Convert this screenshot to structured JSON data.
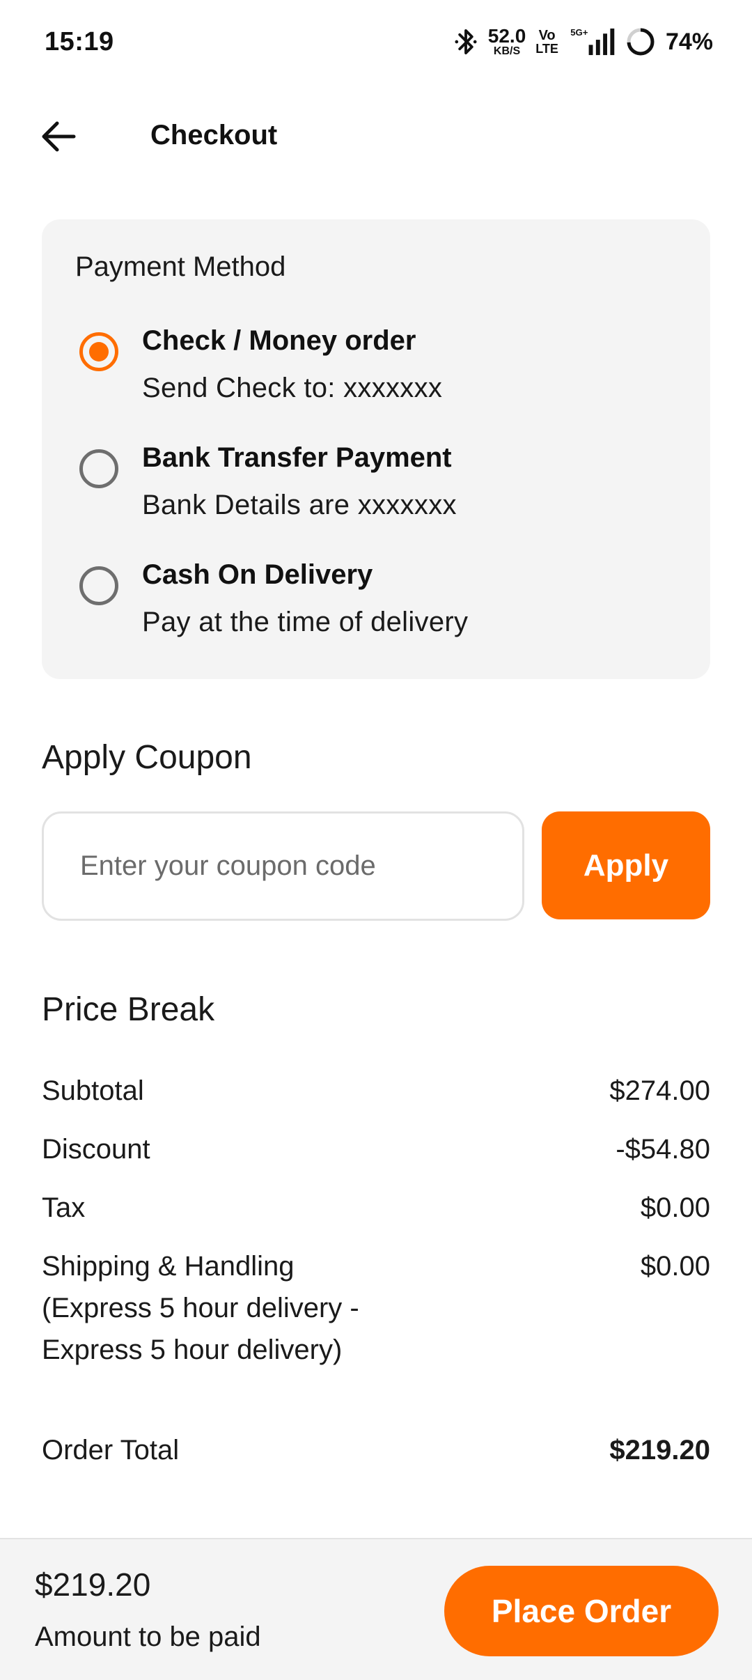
{
  "status_bar": {
    "time": "15:19",
    "net_speed_value": "52.0",
    "net_speed_unit": "KB/S",
    "volte_top": "Vo",
    "volte_bottom": "LTE",
    "network_label": "5G+",
    "battery_percent": "74%",
    "battery_level": 0.74,
    "icons": [
      "bluetooth-icon",
      "signal-icon",
      "battery-icon"
    ]
  },
  "header": {
    "title": "Checkout",
    "back_icon": "arrow-left-icon"
  },
  "payment": {
    "title": "Payment Method",
    "options": [
      {
        "title": "Check / Money order",
        "description": "Send Check to: xxxxxxx",
        "selected": true
      },
      {
        "title": "Bank Transfer Payment",
        "description": "Bank Details are xxxxxxx",
        "selected": false
      },
      {
        "title": "Cash On Delivery",
        "description": "Pay at the time of delivery",
        "selected": false
      }
    ]
  },
  "coupon": {
    "heading": "Apply Coupon",
    "placeholder": "Enter your coupon code",
    "value": "",
    "apply_label": "Apply"
  },
  "price_break": {
    "heading": "Price Break",
    "rows": [
      {
        "label": "Subtotal",
        "value": "$274.00"
      },
      {
        "label": "Discount",
        "value": "-$54.80"
      },
      {
        "label": "Tax",
        "value": "$0.00"
      },
      {
        "label": "Shipping & Handling (Express 5 hour delivery - Express 5 hour delivery)",
        "value": "$0.00"
      },
      {
        "label": "Order Total",
        "value": "$219.20"
      }
    ]
  },
  "footer": {
    "amount": "$219.20",
    "amount_label": "Amount to be paid",
    "place_order_label": "Place Order"
  },
  "colors": {
    "accent": "#ff6d00",
    "card_background": "#f4f4f4",
    "text": "#1a1a1a"
  }
}
